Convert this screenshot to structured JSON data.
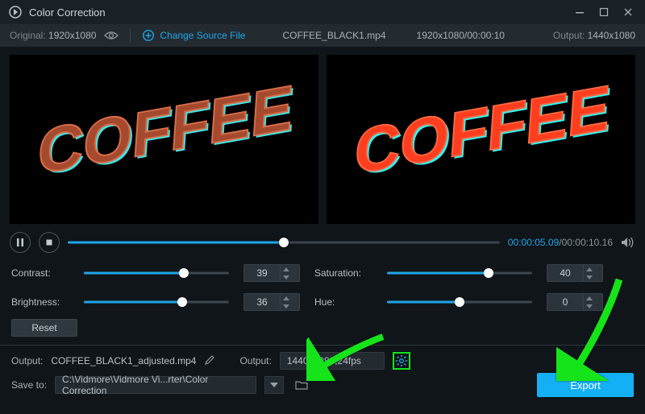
{
  "colors": {
    "accent": "#1fa6e8",
    "export": "#13b0f5",
    "highlight_green": "#16e41a",
    "text_muted": "#a9b1b6",
    "bg": "#0f1519"
  },
  "window": {
    "title": "Color Correction"
  },
  "infobar": {
    "original_label": "Original:",
    "original_res": "1920x1080",
    "change_source": "Change Source File",
    "filename": "COFFEE_BLACK1.mp4",
    "res_time": "1920x1080/00:00:10",
    "output_label": "Output:",
    "output_res": "1440x1080"
  },
  "preview": {
    "text": "COFFEE"
  },
  "timeline": {
    "current": "00:00:05.09",
    "total": "00:00:10.16",
    "progress_pct": 50
  },
  "sliders": {
    "contrast": {
      "label": "Contrast:",
      "value": "39",
      "pct": 69
    },
    "saturation": {
      "label": "Saturation:",
      "value": "40",
      "pct": 70
    },
    "brightness": {
      "label": "Brightness:",
      "value": "36",
      "pct": 68
    },
    "hue": {
      "label": "Hue:",
      "value": "0",
      "pct": 50
    }
  },
  "reset_label": "Reset",
  "output": {
    "label": "Output:",
    "filename": "COFFEE_BLACK1_adjusted.mp4",
    "fmt_label": "Output:",
    "fmt_value": "1440x1080;24fps"
  },
  "save": {
    "label": "Save to:",
    "path": "C:\\Vidmore\\Vidmore Vi...rter\\Color Correction"
  },
  "export_label": "Export"
}
